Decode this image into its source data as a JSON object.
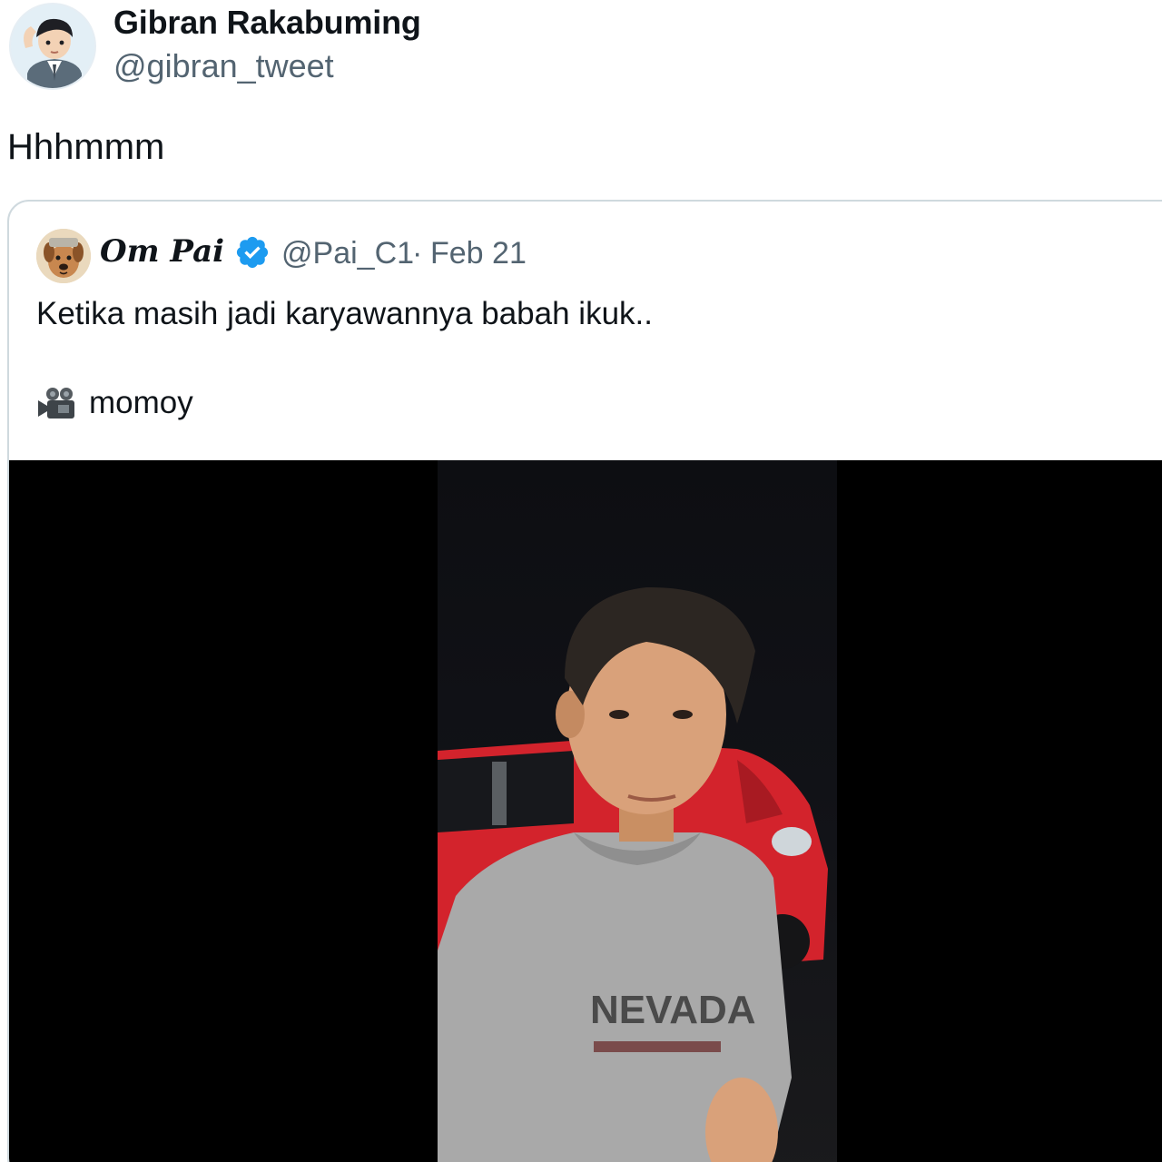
{
  "author": {
    "name": "Gibran Rakabuming",
    "handle": "@gibran_tweet",
    "avatar_icon": "cartoon-avatar-icon"
  },
  "tweet": {
    "text": "Hhhmmm"
  },
  "quoted": {
    "name": "Om Pai",
    "verified_icon": "verified-badge-icon",
    "handle": "@Pai_C1",
    "separator": "·",
    "date": "Feb 21",
    "text": "Ketika masih jadi karyawannya babah ikuk..",
    "credit_icon": "movie-camera-icon",
    "credit": "momoy",
    "avatar_icon": "dog-avatar-icon"
  },
  "colors": {
    "text": "#0f1419",
    "secondary": "#536471",
    "verified": "#1d9bf0",
    "border": "#cfd9de"
  }
}
